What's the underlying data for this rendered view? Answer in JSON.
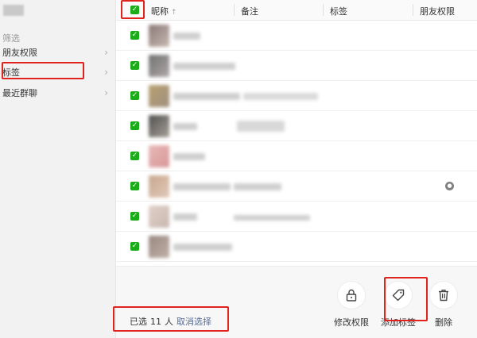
{
  "sidebar": {
    "section_label": "筛选",
    "items": [
      {
        "label": "朋友权限"
      },
      {
        "label": "标签"
      },
      {
        "label": "最近群聊"
      }
    ]
  },
  "header": {
    "columns": [
      {
        "label": "昵称",
        "sort_icon": "↑"
      },
      {
        "label": "备注"
      },
      {
        "label": "标签"
      },
      {
        "label": "朋友权限"
      }
    ]
  },
  "rows_visible": 8,
  "bottom_bar": {
    "selected_prefix": "已选",
    "selected_count": "11",
    "selected_unit": "人",
    "deselect_label": "取消选择",
    "actions": [
      {
        "label": "修改权限",
        "icon": "lock-icon"
      },
      {
        "label": "添加标签",
        "icon": "tag-icon"
      },
      {
        "label": "删除",
        "icon": "trash-icon"
      }
    ]
  },
  "colors": {
    "accent_green": "#1aad19",
    "link_blue": "#576b95",
    "annotation_red": "#e0231d"
  }
}
